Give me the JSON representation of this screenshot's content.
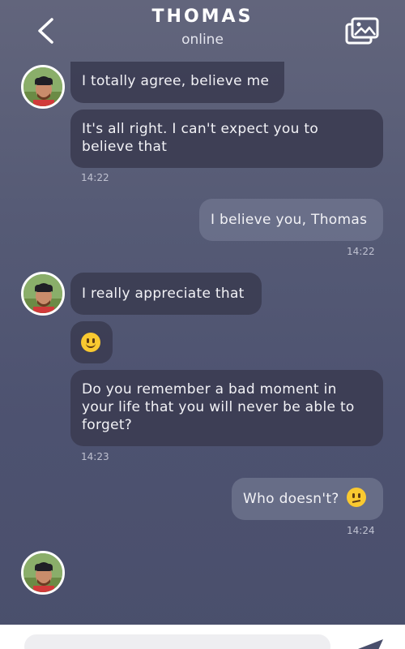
{
  "header": {
    "contact_name": "THOMAS",
    "status": "online",
    "back_icon": "chevron-left-icon",
    "gallery_icon": "image-gallery-icon"
  },
  "messages": [
    {
      "direction": "incoming",
      "text": "I totally agree, believe me"
    },
    {
      "direction": "incoming",
      "text": "It's all right. I can't expect you to believe that",
      "time": "14:22"
    },
    {
      "direction": "outgoing",
      "text": "I believe you, Thomas",
      "time": "14:22"
    },
    {
      "direction": "incoming",
      "text": "I really appreciate that"
    },
    {
      "direction": "incoming",
      "emoji": "slightly-smiling-face"
    },
    {
      "direction": "incoming",
      "text": "Do you remember a bad moment in your life that you will never be able to forget?",
      "time": "14:23"
    },
    {
      "direction": "outgoing",
      "text": "Who doesn't?",
      "emoji": "confused-face",
      "time": "14:24"
    }
  ],
  "composer": {
    "placeholder": "",
    "send_icon": "send-icon"
  },
  "colors": {
    "incoming_bubble": "#3c3d52",
    "outgoing_bubble": "#70748e",
    "background": "#555a75"
  }
}
